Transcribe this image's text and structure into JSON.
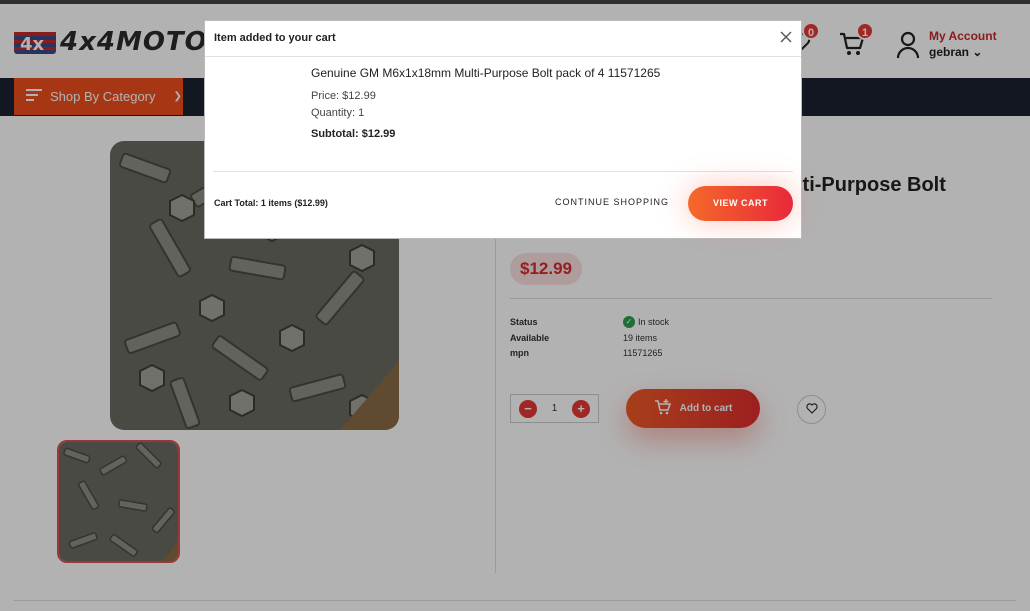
{
  "header": {
    "logo_text": "4x4MOTORS",
    "wishlist_count": "0",
    "cart_count": "1",
    "account_label": "My Account",
    "account_user": "gebran"
  },
  "nav": {
    "shop_by_category": "Shop By Category"
  },
  "product": {
    "title_visible": "lti-Purpose Bolt",
    "price": "$12.99",
    "specs": [
      {
        "label": "Status",
        "value": "In stock"
      },
      {
        "label": "Available",
        "value": "19 items"
      },
      {
        "label": "mpn",
        "value": "11571265"
      }
    ],
    "quantity": "1",
    "add_to_cart": "Add to cart"
  },
  "modal": {
    "title": "Item added to your cart",
    "item_name": "Genuine GM M6x1x18mm Multi-Purpose Bolt pack of 4 11571265",
    "price_line": "Price: $12.99",
    "quantity_line": "Quantity: 1",
    "subtotal_line": "Subtotal: $12.99",
    "cart_total": "Cart Total: 1 items ($12.99)",
    "continue_label": "CONTINUE SHOPPING",
    "view_cart_label": "VIEW CART"
  },
  "colors": {
    "accent": "#f0501e",
    "price_red": "#d32f2f",
    "in_stock_green": "#2e9e4f",
    "navbar": "#1c2230"
  },
  "icons": [
    "wishlist-icon",
    "cart-icon",
    "user-icon",
    "menu-icon",
    "chevron-down-icon",
    "check-icon",
    "minus-icon",
    "plus-icon",
    "cart-plus-icon",
    "heart-icon",
    "close-icon"
  ]
}
